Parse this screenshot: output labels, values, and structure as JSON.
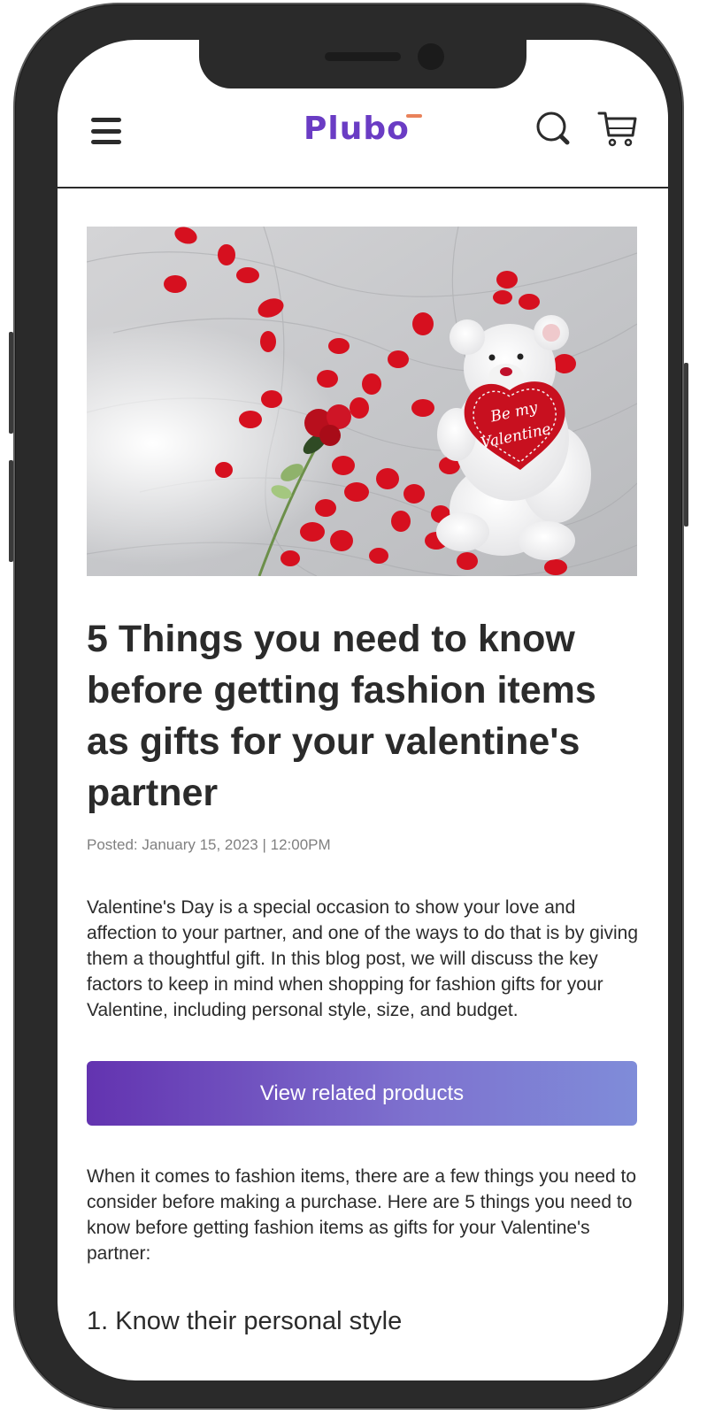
{
  "header": {
    "logo_text": "Plubo",
    "menu_icon": "hamburger-menu-icon",
    "search_icon": "search-icon",
    "cart_icon": "shopping-cart-icon"
  },
  "hero": {
    "image_subject": "white teddy bear holding a red heart pillow on white sheets with red rose petals and a red rose",
    "heart_text": "Be my Valentine"
  },
  "article": {
    "title": "5 Things you need to know before getting fashion items as gifts for your valentine's partner",
    "posted": "Posted: January 15, 2023 | 12:00PM",
    "intro": "Valentine's Day is a special occasion to show your love and affection to your partner, and one of the ways to do that is by giving them a thoughtful gift. In this blog post, we will discuss the key factors to keep in mind when shopping for fashion gifts for your Valentine, including personal style, size, and budget.",
    "cta_label": "View related products",
    "body": "When it comes to fashion items, there are a few things you need to consider before making a purchase. Here are 5 things you need to know before getting fashion items as gifts for your Valentine's partner:",
    "section_heading": "1. Know their personal style"
  },
  "colors": {
    "brand": "#6a3cc4",
    "logo_accent": "#e9825a",
    "cta_gradient_start": "#6333b0",
    "cta_gradient_end": "#7f8cd9",
    "text": "#2b2b2b",
    "muted_text": "#808080",
    "phone_frame": "#2a2a2a"
  }
}
